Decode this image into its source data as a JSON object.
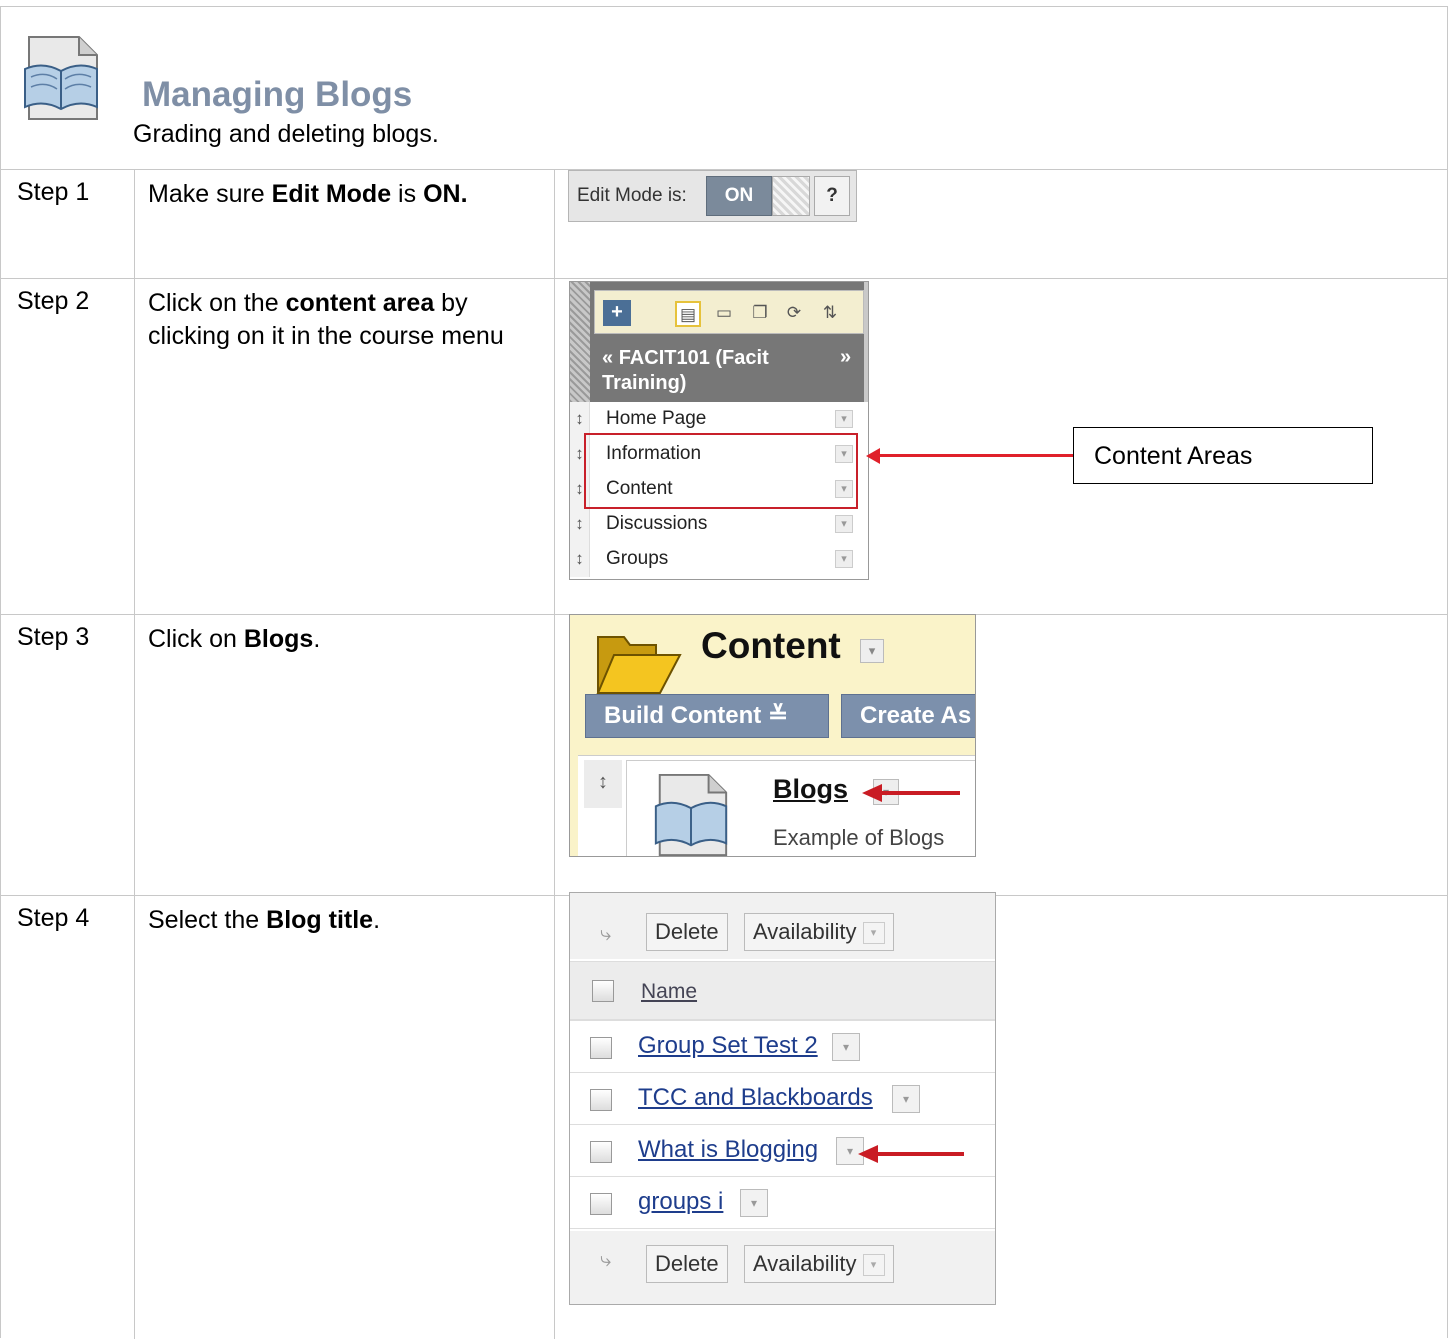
{
  "header": {
    "title": "Managing Blogs",
    "subtitle": "Grading and deleting blogs."
  },
  "steps": [
    {
      "label": "Step 1",
      "desc": [
        "Make sure ",
        "Edit Mode",
        " is ",
        "ON."
      ]
    },
    {
      "label": "Step 2",
      "desc": [
        "Click on the ",
        "content area",
        " by clicking on it in the course menu"
      ]
    },
    {
      "label": "Step 3",
      "desc": [
        "Click on ",
        "Blogs",
        "."
      ]
    },
    {
      "label": "Step 4",
      "desc": [
        "Select the ",
        "Blog title",
        "."
      ]
    }
  ],
  "edit_mode": {
    "label": "Edit Mode is:",
    "state": "ON",
    "help": "?"
  },
  "course_menu": {
    "course": "FACIT101 (Facit Training)",
    "items": [
      "Home Page",
      "Information",
      "Content",
      "Discussions",
      "Groups"
    ],
    "callout": "Content Areas"
  },
  "content_area": {
    "title": "Content",
    "build_btn": "Build Content",
    "create_btn": "Create As",
    "item_title": "Blogs",
    "item_desc": "Example of Blogs"
  },
  "blog_list": {
    "delete_btn": "Delete",
    "availability_btn": "Availability",
    "column": "Name",
    "rows": [
      "Group Set Test 2",
      "TCC and Blackboards",
      "What is Blogging",
      "groups i"
    ]
  },
  "colors": {
    "accent_red": "#e0202a",
    "title_gray": "#7f8fa6",
    "button_blue": "#7c90ac"
  }
}
